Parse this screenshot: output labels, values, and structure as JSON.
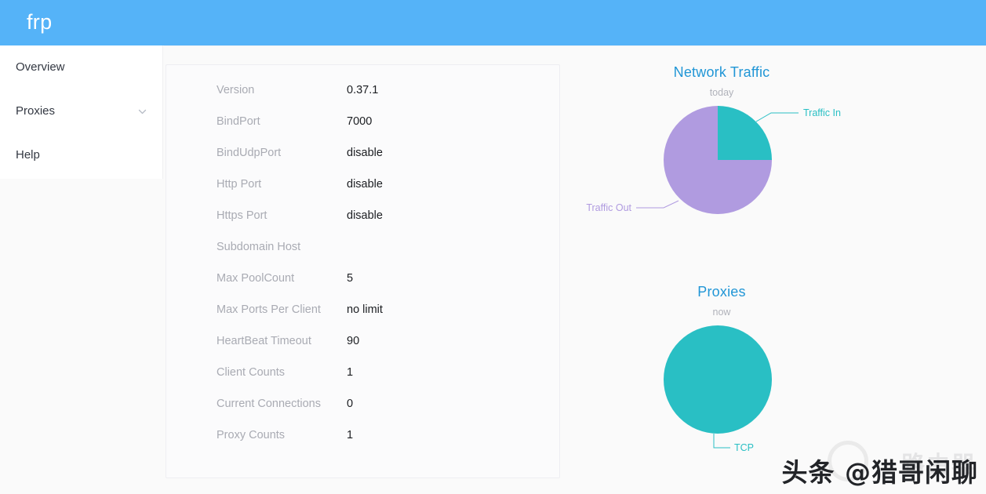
{
  "header": {
    "brand": "frp"
  },
  "sidebar": {
    "items": [
      {
        "label": "Overview",
        "icon": "",
        "expandable": false
      },
      {
        "label": "Proxies",
        "icon": "chevron-down-icon",
        "expandable": true
      },
      {
        "label": "Help",
        "icon": "",
        "expandable": false
      }
    ]
  },
  "server_info": {
    "rows": [
      {
        "key": "Version",
        "value": "0.37.1"
      },
      {
        "key": "BindPort",
        "value": "7000"
      },
      {
        "key": "BindUdpPort",
        "value": "disable"
      },
      {
        "key": "Http Port",
        "value": "disable"
      },
      {
        "key": "Https Port",
        "value": "disable"
      },
      {
        "key": "Subdomain Host",
        "value": ""
      },
      {
        "key": "Max PoolCount",
        "value": "5"
      },
      {
        "key": "Max Ports Per Client",
        "value": "no limit"
      },
      {
        "key": "HeartBeat Timeout",
        "value": "90"
      },
      {
        "key": "Client Counts",
        "value": "1"
      },
      {
        "key": "Current Connections",
        "value": "0"
      },
      {
        "key": "Proxy Counts",
        "value": "1"
      }
    ]
  },
  "chart_data": [
    {
      "type": "pie",
      "title": "Network Traffic",
      "subtitle": "today",
      "categories": [
        "Traffic In",
        "Traffic Out"
      ],
      "values": [
        25,
        75
      ],
      "colors": [
        "#29bfc4",
        "#b09be0"
      ],
      "legend_position": "outside-labels",
      "labels": [
        {
          "name": "Traffic In",
          "color": "#29bfc4"
        },
        {
          "name": "Traffic Out",
          "color": "#b09be0"
        }
      ]
    },
    {
      "type": "pie",
      "title": "Proxies",
      "subtitle": "now",
      "categories": [
        "TCP"
      ],
      "values": [
        100
      ],
      "colors": [
        "#29bfc4"
      ],
      "legend_position": "outside-labels",
      "labels": [
        {
          "name": "TCP",
          "color": "#29bfc4"
        }
      ]
    }
  ],
  "watermark": {
    "text": "头条 @猎哥闲聊",
    "ghost": "路由器"
  },
  "theme": {
    "header_bg": "#55b3f8",
    "accent": "#2196d6",
    "teal": "#29bfc4",
    "purple": "#b09be0",
    "page_bg": "#fafafa"
  }
}
